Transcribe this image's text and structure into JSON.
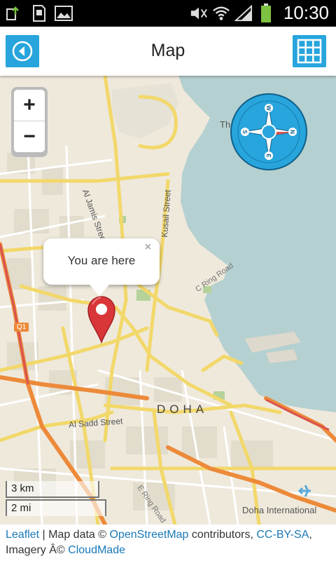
{
  "status_bar": {
    "time": "10:30",
    "left_icons": [
      "upload-icon",
      "sd-card-icon",
      "image-icon"
    ],
    "right_icons": [
      "mute-icon",
      "wifi-icon",
      "signal-icon",
      "battery-icon"
    ]
  },
  "app_bar": {
    "title": "Map",
    "back_icon": "back-arrow-icon",
    "menu_icon": "grid-icon",
    "accent_color": "#27a5dc"
  },
  "map": {
    "zoom_in_label": "+",
    "zoom_out_label": "−",
    "popup": {
      "text": "You are here",
      "close_label": "×"
    },
    "labels": {
      "city": "DOHA",
      "street_1": "Al Jamis Street",
      "street_2": "Kusail Street",
      "street_3": "Al Sadd Street",
      "street_4": "C Ring Road",
      "street_5": "E Ring Road",
      "airport": "Doha International",
      "road_shield": "Q1",
      "island": "Th"
    },
    "compass": {
      "n": "N",
      "e": "E",
      "s": "S",
      "w": "W"
    },
    "scale": {
      "metric": "3 km",
      "imperial": "2 mi"
    }
  },
  "attribution": {
    "leaflet": "Leaflet",
    "sep": " | Map data © ",
    "osm": "OpenStreetMap",
    "contributors": " contributors, ",
    "license": "CC-BY-SA",
    "comma": ",",
    "imagery": "Imagery Â© ",
    "cloudmade": "CloudMade"
  }
}
